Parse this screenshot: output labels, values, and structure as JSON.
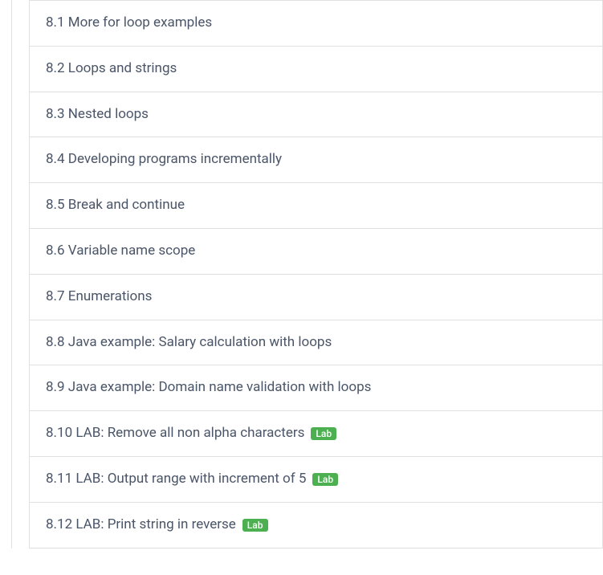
{
  "sections": [
    {
      "text": "8.1 More for loop examples",
      "hasLab": false
    },
    {
      "text": "8.2 Loops and strings",
      "hasLab": false
    },
    {
      "text": "8.3 Nested loops",
      "hasLab": false
    },
    {
      "text": "8.4 Developing programs incrementally",
      "hasLab": false
    },
    {
      "text": "8.5 Break and continue",
      "hasLab": false
    },
    {
      "text": "8.6 Variable name scope",
      "hasLab": false
    },
    {
      "text": "8.7 Enumerations",
      "hasLab": false
    },
    {
      "text": "8.8 Java example: Salary calculation with loops",
      "hasLab": false
    },
    {
      "text": "8.9 Java example: Domain name validation with loops",
      "hasLab": false
    },
    {
      "text": "8.10 LAB: Remove all non alpha characters",
      "hasLab": true
    },
    {
      "text": "8.11 LAB: Output range with increment of 5",
      "hasLab": true
    },
    {
      "text": "8.12 LAB: Print string in reverse",
      "hasLab": true
    }
  ],
  "labBadgeText": "Lab"
}
